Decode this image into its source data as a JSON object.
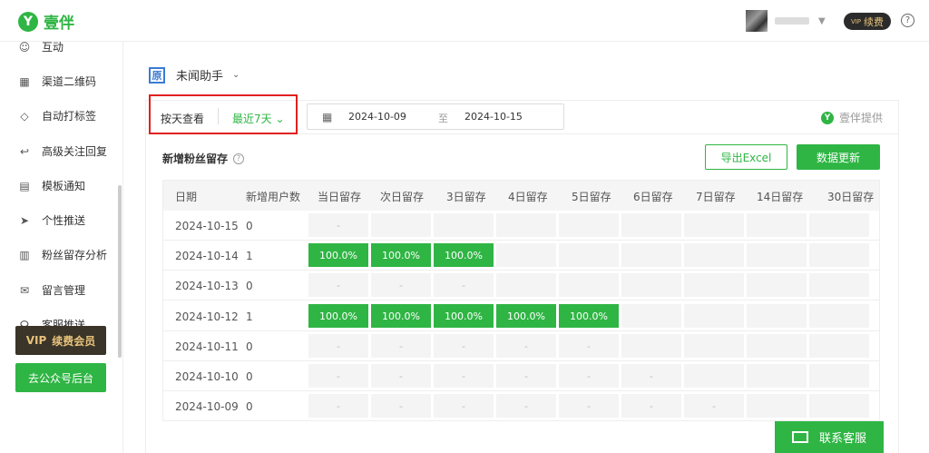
{
  "app": {
    "logo_letter": "Y",
    "name": "壹伴"
  },
  "topbar": {
    "vip_badge": "续费",
    "vip_mini": "VIP",
    "help": "?"
  },
  "sidebar": {
    "items": [
      {
        "label": "互动",
        "icon": "interact-icon"
      },
      {
        "label": "渠道二维码",
        "icon": "qrcode-icon"
      },
      {
        "label": "自动打标签",
        "icon": "tag-icon"
      },
      {
        "label": "高级关注回复",
        "icon": "reply-icon"
      },
      {
        "label": "模板通知",
        "icon": "template-icon"
      },
      {
        "label": "个性推送",
        "icon": "send-icon"
      },
      {
        "label": "粉丝留存分析",
        "icon": "chart-icon"
      },
      {
        "label": "留言管理",
        "icon": "message-icon"
      },
      {
        "label": "客服推送",
        "icon": "headset-icon"
      }
    ],
    "vip_button": "续费会员",
    "vip_mini": "VIP",
    "gz_button": "去公众号后台"
  },
  "account": {
    "icon_text": "原",
    "name": "未闻助手"
  },
  "filter": {
    "by_day": "按天查看",
    "range": "最近7天",
    "start_date": "2024-10-09",
    "to": "至",
    "end_date": "2024-10-15",
    "provided_mark": "Y",
    "provided": "壹伴提供"
  },
  "section": {
    "title": "新增粉丝留存",
    "help": "?"
  },
  "buttons": {
    "export": "导出Excel",
    "update": "数据更新"
  },
  "table": {
    "headers": [
      "日期",
      "新增用户数",
      "当日留存",
      "次日留存",
      "3日留存",
      "4日留存",
      "5日留存",
      "6日留存",
      "7日留存",
      "14日留存",
      "30日留存"
    ],
    "rows": [
      {
        "date": "2024-10-15",
        "new": "0",
        "cells": [
          "-",
          "",
          "",
          "",
          "",
          "",
          "",
          "",
          ""
        ]
      },
      {
        "date": "2024-10-14",
        "new": "1",
        "cells": [
          "100.0%",
          "100.0%",
          "100.0%",
          "",
          "",
          "",
          "",
          "",
          ""
        ]
      },
      {
        "date": "2024-10-13",
        "new": "0",
        "cells": [
          "-",
          "-",
          "-",
          "",
          "",
          "",
          "",
          "",
          ""
        ]
      },
      {
        "date": "2024-10-12",
        "new": "1",
        "cells": [
          "100.0%",
          "100.0%",
          "100.0%",
          "100.0%",
          "100.0%",
          "",
          "",
          "",
          ""
        ]
      },
      {
        "date": "2024-10-11",
        "new": "0",
        "cells": [
          "-",
          "-",
          "-",
          "-",
          "-",
          "",
          "",
          "",
          ""
        ]
      },
      {
        "date": "2024-10-10",
        "new": "0",
        "cells": [
          "-",
          "-",
          "-",
          "-",
          "-",
          "-",
          "",
          "",
          ""
        ]
      },
      {
        "date": "2024-10-09",
        "new": "0",
        "cells": [
          "-",
          "-",
          "-",
          "-",
          "-",
          "-",
          "-",
          "",
          ""
        ]
      }
    ]
  },
  "contact": {
    "label": "联系客服"
  },
  "colors": {
    "brand": "#2fb544",
    "highlight": "#e02020"
  }
}
